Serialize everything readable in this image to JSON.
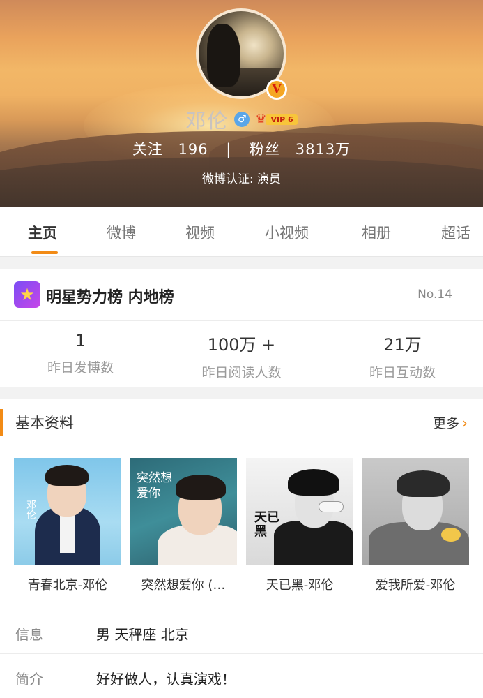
{
  "profile": {
    "name": "邓伦",
    "vip_level": "VIP 6",
    "verified_badge": "V",
    "following_label": "关注",
    "following_count": "196",
    "stat_separator": "|",
    "followers_label": "粉丝",
    "followers_count": "3813万",
    "verification": "微博认证: 演员"
  },
  "tabs": [
    {
      "label": "主页",
      "active": true
    },
    {
      "label": "微博",
      "active": false
    },
    {
      "label": "视频",
      "active": false
    },
    {
      "label": "小视频",
      "active": false
    },
    {
      "label": "相册",
      "active": false
    },
    {
      "label": "超话",
      "active": false
    }
  ],
  "ranking": {
    "title": "明星势力榜 内地榜",
    "rank": "No.14",
    "stats": [
      {
        "value": "1",
        "label": "昨日发博数"
      },
      {
        "value": "100万 +",
        "label": "昨日阅读人数"
      },
      {
        "value": "21万",
        "label": "昨日互动数"
      }
    ]
  },
  "basic_info": {
    "title": "基本资料",
    "more_label": "更多",
    "albums": [
      {
        "title": "青春北京-邓伦",
        "cover_text": "邓伦"
      },
      {
        "title": "突然想爱你 (…",
        "cover_text": "突然想爱你"
      },
      {
        "title": "天已黑-邓伦",
        "cover_text": "天已黑"
      },
      {
        "title": "爱我所爱-邓伦",
        "cover_text": ""
      }
    ],
    "rows": [
      {
        "key": "信息",
        "value": "男 天秤座 北京"
      },
      {
        "key": "简介",
        "value": "好好做人，认真演戏！"
      }
    ]
  },
  "colors": {
    "accent": "#f28b16",
    "vip_gold": "#f8c53a",
    "gender_blue": "#5aa6e8",
    "rank_icon": "#7b4df5"
  },
  "icons": {
    "gender": "male-icon",
    "vip": "crown-icon",
    "rank": "star-icon",
    "more": "chevron-right-icon"
  }
}
